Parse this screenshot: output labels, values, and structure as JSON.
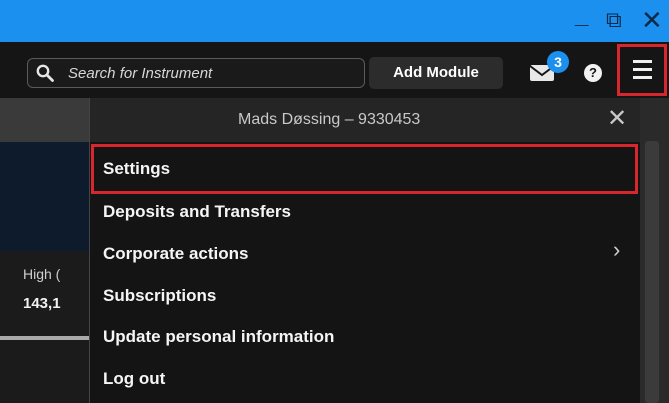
{
  "window": {
    "controls": {
      "minimize": "_",
      "maximize": "⧉",
      "close": "✕"
    }
  },
  "toolbar": {
    "search": {
      "placeholder": "Search for Instrument"
    },
    "add_module_label": "Add Module",
    "notifications_count": "3",
    "help_label": "?"
  },
  "background": {
    "high_label": "High (",
    "high_value": "143,1"
  },
  "menu": {
    "user": "Mads Døssing – 9330453",
    "close": "✕",
    "items": [
      {
        "label": "Settings",
        "highlighted": true
      },
      {
        "label": "Deposits and Transfers"
      },
      {
        "label": "Corporate actions",
        "has_submenu": true
      },
      {
        "label": "Subscriptions"
      },
      {
        "label": "Update personal information"
      },
      {
        "label": "Log out"
      }
    ],
    "submenu_glyph": "›"
  },
  "colors": {
    "titlebar": "#1c90ee",
    "highlight_outline": "#d8262f",
    "badge": "#1c90ee"
  },
  "icons": [
    "search-icon",
    "mail-icon",
    "help-icon",
    "hamburger-icon",
    "close-icon",
    "chevron-right-icon"
  ]
}
